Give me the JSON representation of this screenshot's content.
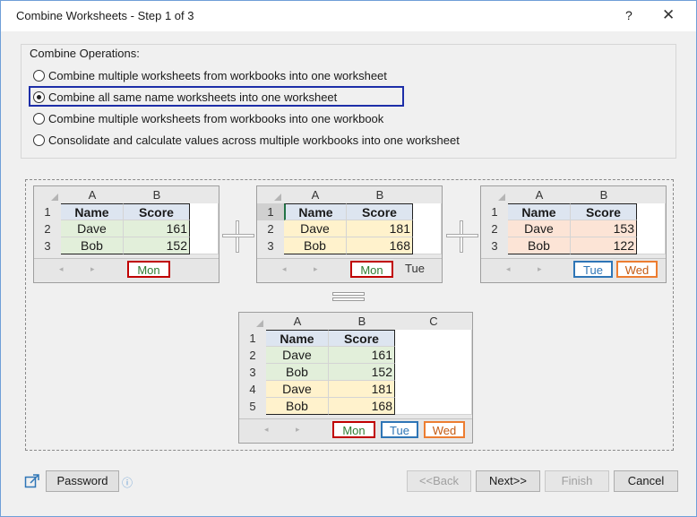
{
  "window": {
    "title": "Combine Worksheets - Step 1 of 3",
    "help_label": "?",
    "close_label": "✕"
  },
  "operations": {
    "legend": "Combine Operations:",
    "options": [
      "Combine multiple worksheets from workbooks into one worksheet",
      "Combine all same name worksheets into one worksheet",
      "Combine multiple worksheets from workbooks into one workbook",
      "Consolidate and calculate values across multiple workbooks into one worksheet"
    ],
    "selected_index": 1
  },
  "preview": {
    "col_headers": [
      "A",
      "B",
      "C"
    ],
    "row_headers": [
      "1",
      "2",
      "3",
      "4",
      "5"
    ],
    "header_name": "Name",
    "header_score": "Score",
    "book1": {
      "rows": [
        [
          "Dave",
          "161"
        ],
        [
          "Bob",
          "152"
        ]
      ],
      "tabs": [
        "Mon"
      ]
    },
    "book2": {
      "rows": [
        [
          "Dave",
          "181"
        ],
        [
          "Bob",
          "168"
        ]
      ],
      "tabs": [
        "Mon",
        "Tue"
      ]
    },
    "book3": {
      "rows": [
        [
          "Dave",
          "153"
        ],
        [
          "Bob",
          "122"
        ]
      ],
      "tabs": [
        "Tue",
        "Wed"
      ]
    },
    "result": {
      "rows": [
        [
          "Dave",
          "161"
        ],
        [
          "Bob",
          "152"
        ],
        [
          "Dave",
          "181"
        ],
        [
          "Bob",
          "168"
        ]
      ],
      "tabs": [
        "Mon",
        "Tue",
        "Wed"
      ]
    },
    "nav_arrows": "◂ ▸"
  },
  "footer": {
    "link_icon": "external-link-icon",
    "password_label": "Password",
    "info_icon": "ⓘ",
    "back_label": "<<Back",
    "next_label": "Next>>",
    "finish_label": "Finish",
    "cancel_label": "Cancel"
  },
  "colors": {
    "green_fill": "#e2efda",
    "yellow_fill": "#fff2cc",
    "peach_fill": "#fce4d6",
    "red_tab": "#c00000",
    "blue_tab": "#2e75b6",
    "orange_tab": "#ed7d31",
    "selection_border": "#1d2ea8"
  }
}
